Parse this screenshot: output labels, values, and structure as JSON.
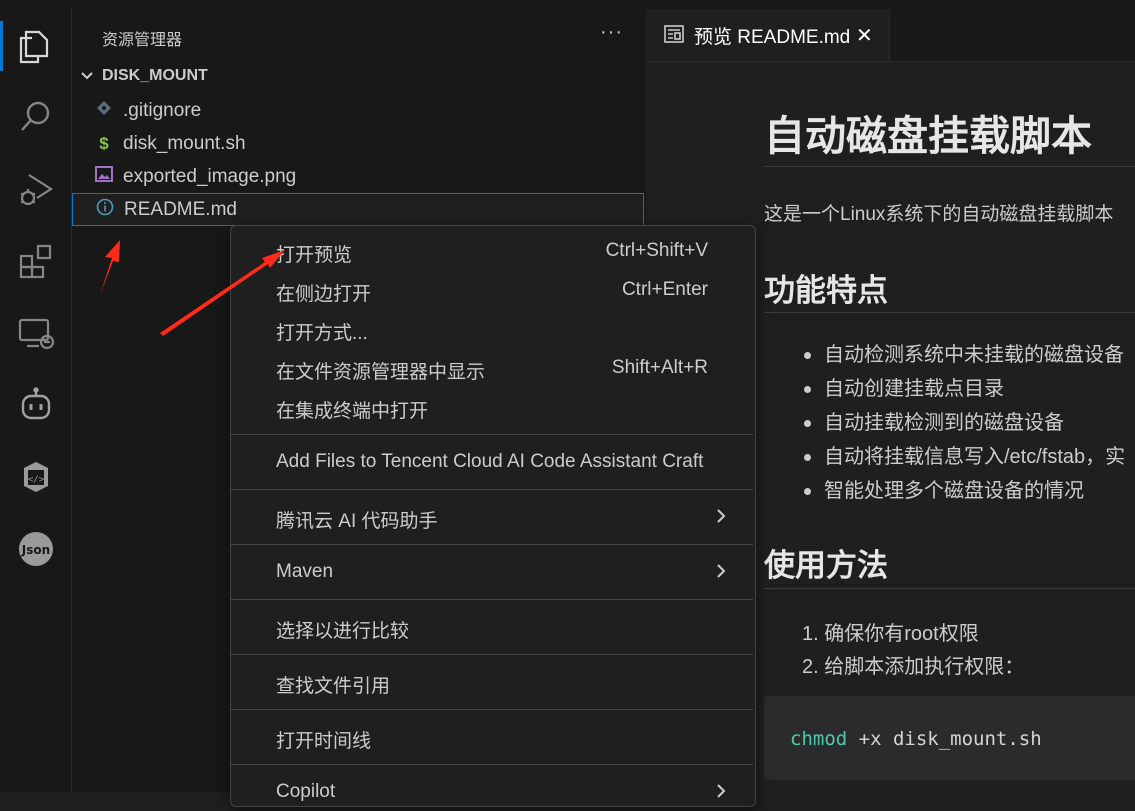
{
  "explorer": {
    "title": "资源管理器",
    "more": "···",
    "folder": "DISK_MOUNT",
    "files": [
      {
        "name": ".gitignore",
        "icon": "git-diamond-icon",
        "color": "#6a7b8c"
      },
      {
        "name": "disk_mount.sh",
        "icon": "dollar-icon",
        "color": "#8bc34a"
      },
      {
        "name": "exported_image.png",
        "icon": "image-icon",
        "color": "#a074c4"
      },
      {
        "name": "README.md",
        "icon": "info-icon",
        "color": "#519aba"
      }
    ]
  },
  "tab": {
    "label": "预览 README.md",
    "close": "✕"
  },
  "preview": {
    "h1": "自动磁盘挂载脚本",
    "intro": "这是一个Linux系统下的自动磁盘挂载脚本",
    "features_title": "功能特点",
    "features": [
      "自动检测系统中未挂载的磁盘设备",
      "自动创建挂载点目录",
      "自动挂载检测到的磁盘设备",
      "自动将挂载信息写入/etc/fstab，实",
      "智能处理多个磁盘设备的情况"
    ],
    "usage_title": "使用方法",
    "steps": [
      "1. 确保你有root权限",
      "2. 给脚本添加执行权限："
    ],
    "code_cmd": "chmod",
    "code_rest": " +x disk_mount.sh"
  },
  "menu": {
    "items": [
      {
        "label": "打开预览",
        "shortcut": "Ctrl+Shift+V"
      },
      {
        "label": "在侧边打开",
        "shortcut": "Ctrl+Enter"
      },
      {
        "label": "打开方式...",
        "shortcut": ""
      },
      {
        "label": "在文件资源管理器中显示",
        "shortcut": "Shift+Alt+R"
      },
      {
        "label": "在集成终端中打开",
        "shortcut": ""
      },
      {
        "label": "Add Files to Tencent Cloud AI Code Assistant Craft",
        "shortcut": ""
      },
      {
        "label": "腾讯云 AI 代码助手",
        "shortcut": ""
      },
      {
        "label": "Maven",
        "shortcut": ""
      },
      {
        "label": "选择以进行比较",
        "shortcut": ""
      },
      {
        "label": "查找文件引用",
        "shortcut": ""
      },
      {
        "label": "打开时间线",
        "shortcut": ""
      },
      {
        "label": "Copilot",
        "shortcut": ""
      }
    ]
  },
  "activity_bar": [
    "files-icon",
    "search-icon",
    "run-debug-icon",
    "extensions-icon",
    "remote-explorer-icon",
    "copilot-bot-icon",
    "code-box-icon",
    "json-icon"
  ],
  "colors": {
    "accent": "#0078d4",
    "annotation_arrow": "#ff2a1a"
  }
}
